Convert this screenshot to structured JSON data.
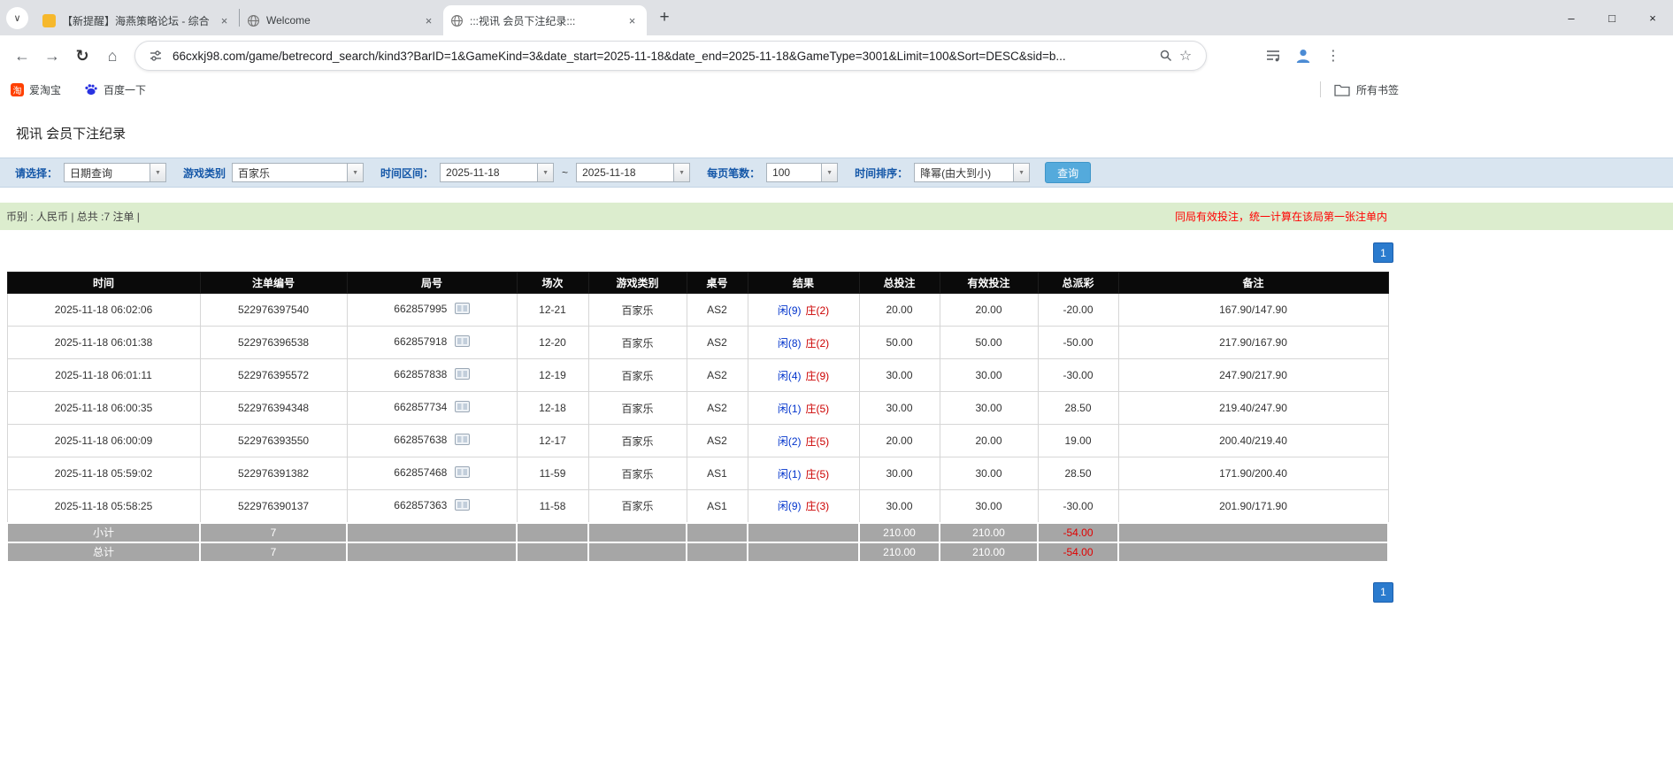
{
  "colors": {
    "accent_blue": "#1a73e8",
    "link_blue": "#0066cc",
    "player_blue": "#0033cc",
    "banker_red": "#cc0000",
    "negative_red": "#e60000",
    "notice_red": "#ff0000",
    "filter_bar_bg": "#d9e5f0",
    "info_bar_bg": "#dcedce",
    "table_header_bg": "#0a0a0a",
    "footer_row_bg": "#a6a6a6",
    "search_button_bg": "#54aadc",
    "pager_bg": "#2b7bce"
  },
  "icons": {
    "tab_search": "∨",
    "close": "×",
    "new_tab": "+",
    "minimize": "–",
    "maximize": "□",
    "back": "←",
    "forward": "→",
    "reload": "↻",
    "home": "⌂",
    "star": "☆",
    "menu": "⋮",
    "dropdown": "▼",
    "taobao_glyph": "淘"
  },
  "browser": {
    "tabs": [
      {
        "title": "【新提醒】海燕策略论坛 - 综合",
        "active": false
      },
      {
        "title": "Welcome",
        "active": false
      },
      {
        "title": ":::视讯 会员下注纪录:::",
        "active": true
      }
    ],
    "url": "66cxkj98.com/game/betrecord_search/kind3?BarID=1&GameKind=3&date_start=2025-11-18&date_end=2025-11-18&GameType=3001&Limit=100&Sort=DESC&sid=b...",
    "bookmarks": [
      {
        "label": "爱淘宝"
      },
      {
        "label": "百度一下"
      }
    ],
    "all_bookmarks_label": "所有书签"
  },
  "page": {
    "title": "视讯 会员下注纪录",
    "filters": {
      "select_label": "请选择：",
      "select_value": "日期查询",
      "game_type_label": "游戏类别",
      "game_type_value": "百家乐",
      "date_range_label": "时间区间：",
      "date_start": "2025-11-18",
      "date_separator": "~",
      "date_end": "2025-11-18",
      "per_page_label": "每页笔数：",
      "per_page_value": "100",
      "sort_label": "时间排序：",
      "sort_value": "降幂(由大到小)",
      "search_button": "查询"
    },
    "info_bar": {
      "summary": "币别 : 人民币 | 总共 :7 注单 |",
      "notice": "同局有效投注，统一计算在该局第一张注单内"
    },
    "pagination": {
      "page": "1"
    },
    "table": {
      "headers": [
        "时间",
        "注单编号",
        "局号",
        "场次",
        "游戏类别",
        "桌号",
        "结果",
        "总投注",
        "有效投注",
        "总派彩",
        "备注"
      ],
      "rows": [
        {
          "time": "2025-11-18 06:02:06",
          "bet_id": "522976397540",
          "round_id": "662857995",
          "session": "12-21",
          "game": "百家乐",
          "table_no": "AS2",
          "result_player": "闲(9)",
          "result_banker": "庄(2)",
          "total_bet": "20.00",
          "valid_bet": "20.00",
          "payout": "-20.00",
          "note": "167.90/147.90"
        },
        {
          "time": "2025-11-18 06:01:38",
          "bet_id": "522976396538",
          "round_id": "662857918",
          "session": "12-20",
          "game": "百家乐",
          "table_no": "AS2",
          "result_player": "闲(8)",
          "result_banker": "庄(2)",
          "total_bet": "50.00",
          "valid_bet": "50.00",
          "payout": "-50.00",
          "note": "217.90/167.90"
        },
        {
          "time": "2025-11-18 06:01:11",
          "bet_id": "522976395572",
          "round_id": "662857838",
          "session": "12-19",
          "game": "百家乐",
          "table_no": "AS2",
          "result_player": "闲(4)",
          "result_banker": "庄(9)",
          "total_bet": "30.00",
          "valid_bet": "30.00",
          "payout": "-30.00",
          "note": "247.90/217.90"
        },
        {
          "time": "2025-11-18 06:00:35",
          "bet_id": "522976394348",
          "round_id": "662857734",
          "session": "12-18",
          "game": "百家乐",
          "table_no": "AS2",
          "result_player": "闲(1)",
          "result_banker": "庄(5)",
          "total_bet": "30.00",
          "valid_bet": "30.00",
          "payout": "28.50",
          "note": "219.40/247.90"
        },
        {
          "time": "2025-11-18 06:00:09",
          "bet_id": "522976393550",
          "round_id": "662857638",
          "session": "12-17",
          "game": "百家乐",
          "table_no": "AS2",
          "result_player": "闲(2)",
          "result_banker": "庄(5)",
          "total_bet": "20.00",
          "valid_bet": "20.00",
          "payout": "19.00",
          "note": "200.40/219.40"
        },
        {
          "time": "2025-11-18 05:59:02",
          "bet_id": "522976391382",
          "round_id": "662857468",
          "session": "11-59",
          "game": "百家乐",
          "table_no": "AS1",
          "result_player": "闲(1)",
          "result_banker": "庄(5)",
          "total_bet": "30.00",
          "valid_bet": "30.00",
          "payout": "28.50",
          "note": "171.90/200.40"
        },
        {
          "time": "2025-11-18 05:58:25",
          "bet_id": "522976390137",
          "round_id": "662857363",
          "session": "11-58",
          "game": "百家乐",
          "table_no": "AS1",
          "result_player": "闲(9)",
          "result_banker": "庄(3)",
          "total_bet": "30.00",
          "valid_bet": "30.00",
          "payout": "-30.00",
          "note": "201.90/171.90"
        }
      ],
      "subtotal": {
        "label": "小计",
        "count": "7",
        "total_bet": "210.00",
        "valid_bet": "210.00",
        "payout": "-54.00"
      },
      "total": {
        "label": "总计",
        "count": "7",
        "total_bet": "210.00",
        "valid_bet": "210.00",
        "payout": "-54.00"
      }
    }
  }
}
